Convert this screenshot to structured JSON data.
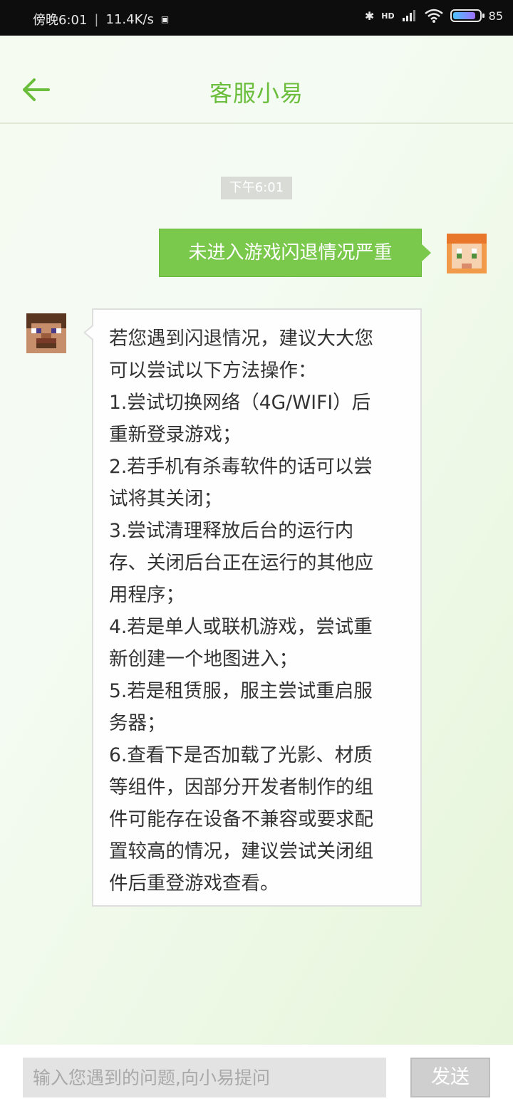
{
  "status_bar": {
    "time": "傍晚6:01",
    "network_speed": "11.4K/s",
    "network_type": "HD",
    "battery_level": "85",
    "battery_percent": 85
  },
  "header": {
    "title": "客服小易",
    "back_icon": "arrow-left-icon"
  },
  "chat": {
    "timestamp": "下午6:01",
    "messages": [
      {
        "sender": "user",
        "lines": [
          "未进入游戏闪退情况严重"
        ]
      },
      {
        "sender": "agent",
        "lines": [
          "若您遇到闪退情况，建议大大您",
          "可以尝试以下方法操作：",
          "1.尝试切换网络（4G/WIFI）后",
          "重新登录游戏；",
          "2.若手机有杀毒软件的话可以尝",
          "试将其关闭；",
          "3.尝试清理释放后台的运行内",
          "存、关闭后台正在运行的其他应",
          "用程序；",
          "4.若是单人或联机游戏，尝试重",
          "新创建一个地图进入；",
          "5.若是租赁服，服主尝试重启服",
          "务器；",
          "6.查看下是否加载了光影、材质",
          "等组件，因部分开发者制作的组",
          "件可能存在设备不兼容或要求配",
          "置较高的情况，建议尝试关闭组",
          "件后重登游戏查看。"
        ]
      }
    ]
  },
  "composer": {
    "placeholder": "输入您遇到的问题,向小易提问",
    "value": "",
    "send_label": "发送"
  },
  "colors": {
    "accent": "#6bbd3c",
    "sent_bubble": "#7ac94c",
    "send_disabled": "#cfcfcf"
  }
}
